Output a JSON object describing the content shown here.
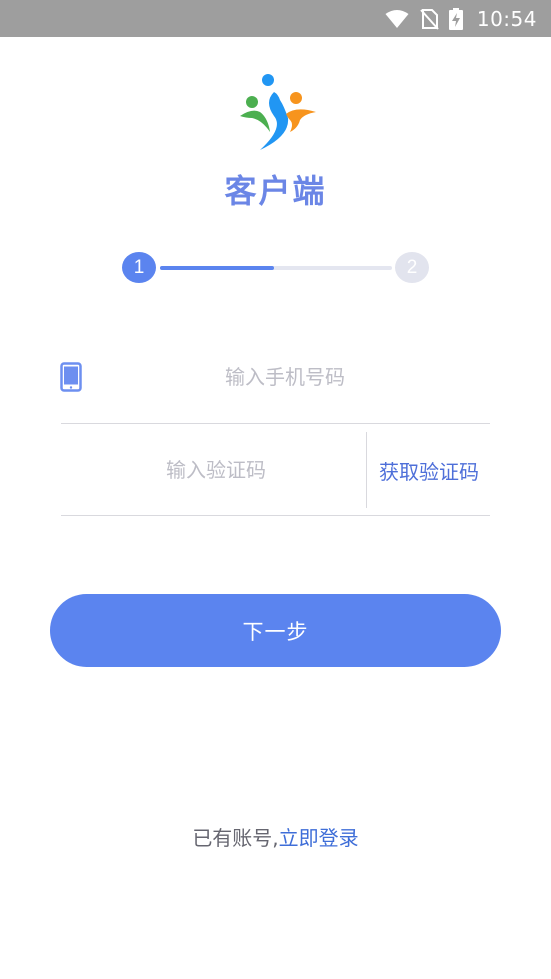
{
  "status_bar": {
    "time": "10:54",
    "icons": [
      "wifi-icon",
      "no-sim-icon",
      "battery-charging-icon"
    ]
  },
  "app": {
    "title": "客户端",
    "logo_icon": "runners-logo-icon",
    "logo_colors": [
      "#4caf50",
      "#2196f3",
      "#f7941d"
    ]
  },
  "stepper": {
    "steps": [
      {
        "label": "1",
        "state": "active"
      },
      {
        "label": "2",
        "state": "inactive"
      }
    ],
    "progress_fraction": 0.5
  },
  "form": {
    "phone": {
      "placeholder": "输入手机号码",
      "value": "",
      "icon": "phone-icon"
    },
    "code": {
      "placeholder": "输入验证码",
      "value": ""
    },
    "get_code_label": "获取验证码"
  },
  "actions": {
    "next_label": "下一步"
  },
  "footer": {
    "prefix": "已有账号,",
    "login_link": "立即登录"
  },
  "colors": {
    "accent": "#5b84ef",
    "link": "#3f6ed8",
    "status_bar": "#9e9e9e"
  }
}
